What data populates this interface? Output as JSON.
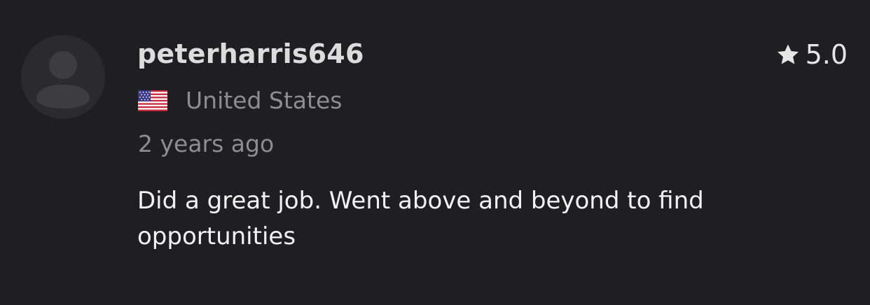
{
  "review": {
    "username": "peterharris646",
    "rating": "5.0",
    "country": "United States",
    "flag_icon": "us-flag-icon",
    "time_ago": "2 years ago",
    "text": "Did a great job. Went above and beyond to find opportunities"
  },
  "colors": {
    "background": "#1f1f21",
    "username": "#dcdcdc",
    "muted_text": "#8d8d92",
    "body_text": "#f2f2f2",
    "avatar_bg": "#2b2b2d",
    "avatar_fg": "#3d3d3f"
  }
}
